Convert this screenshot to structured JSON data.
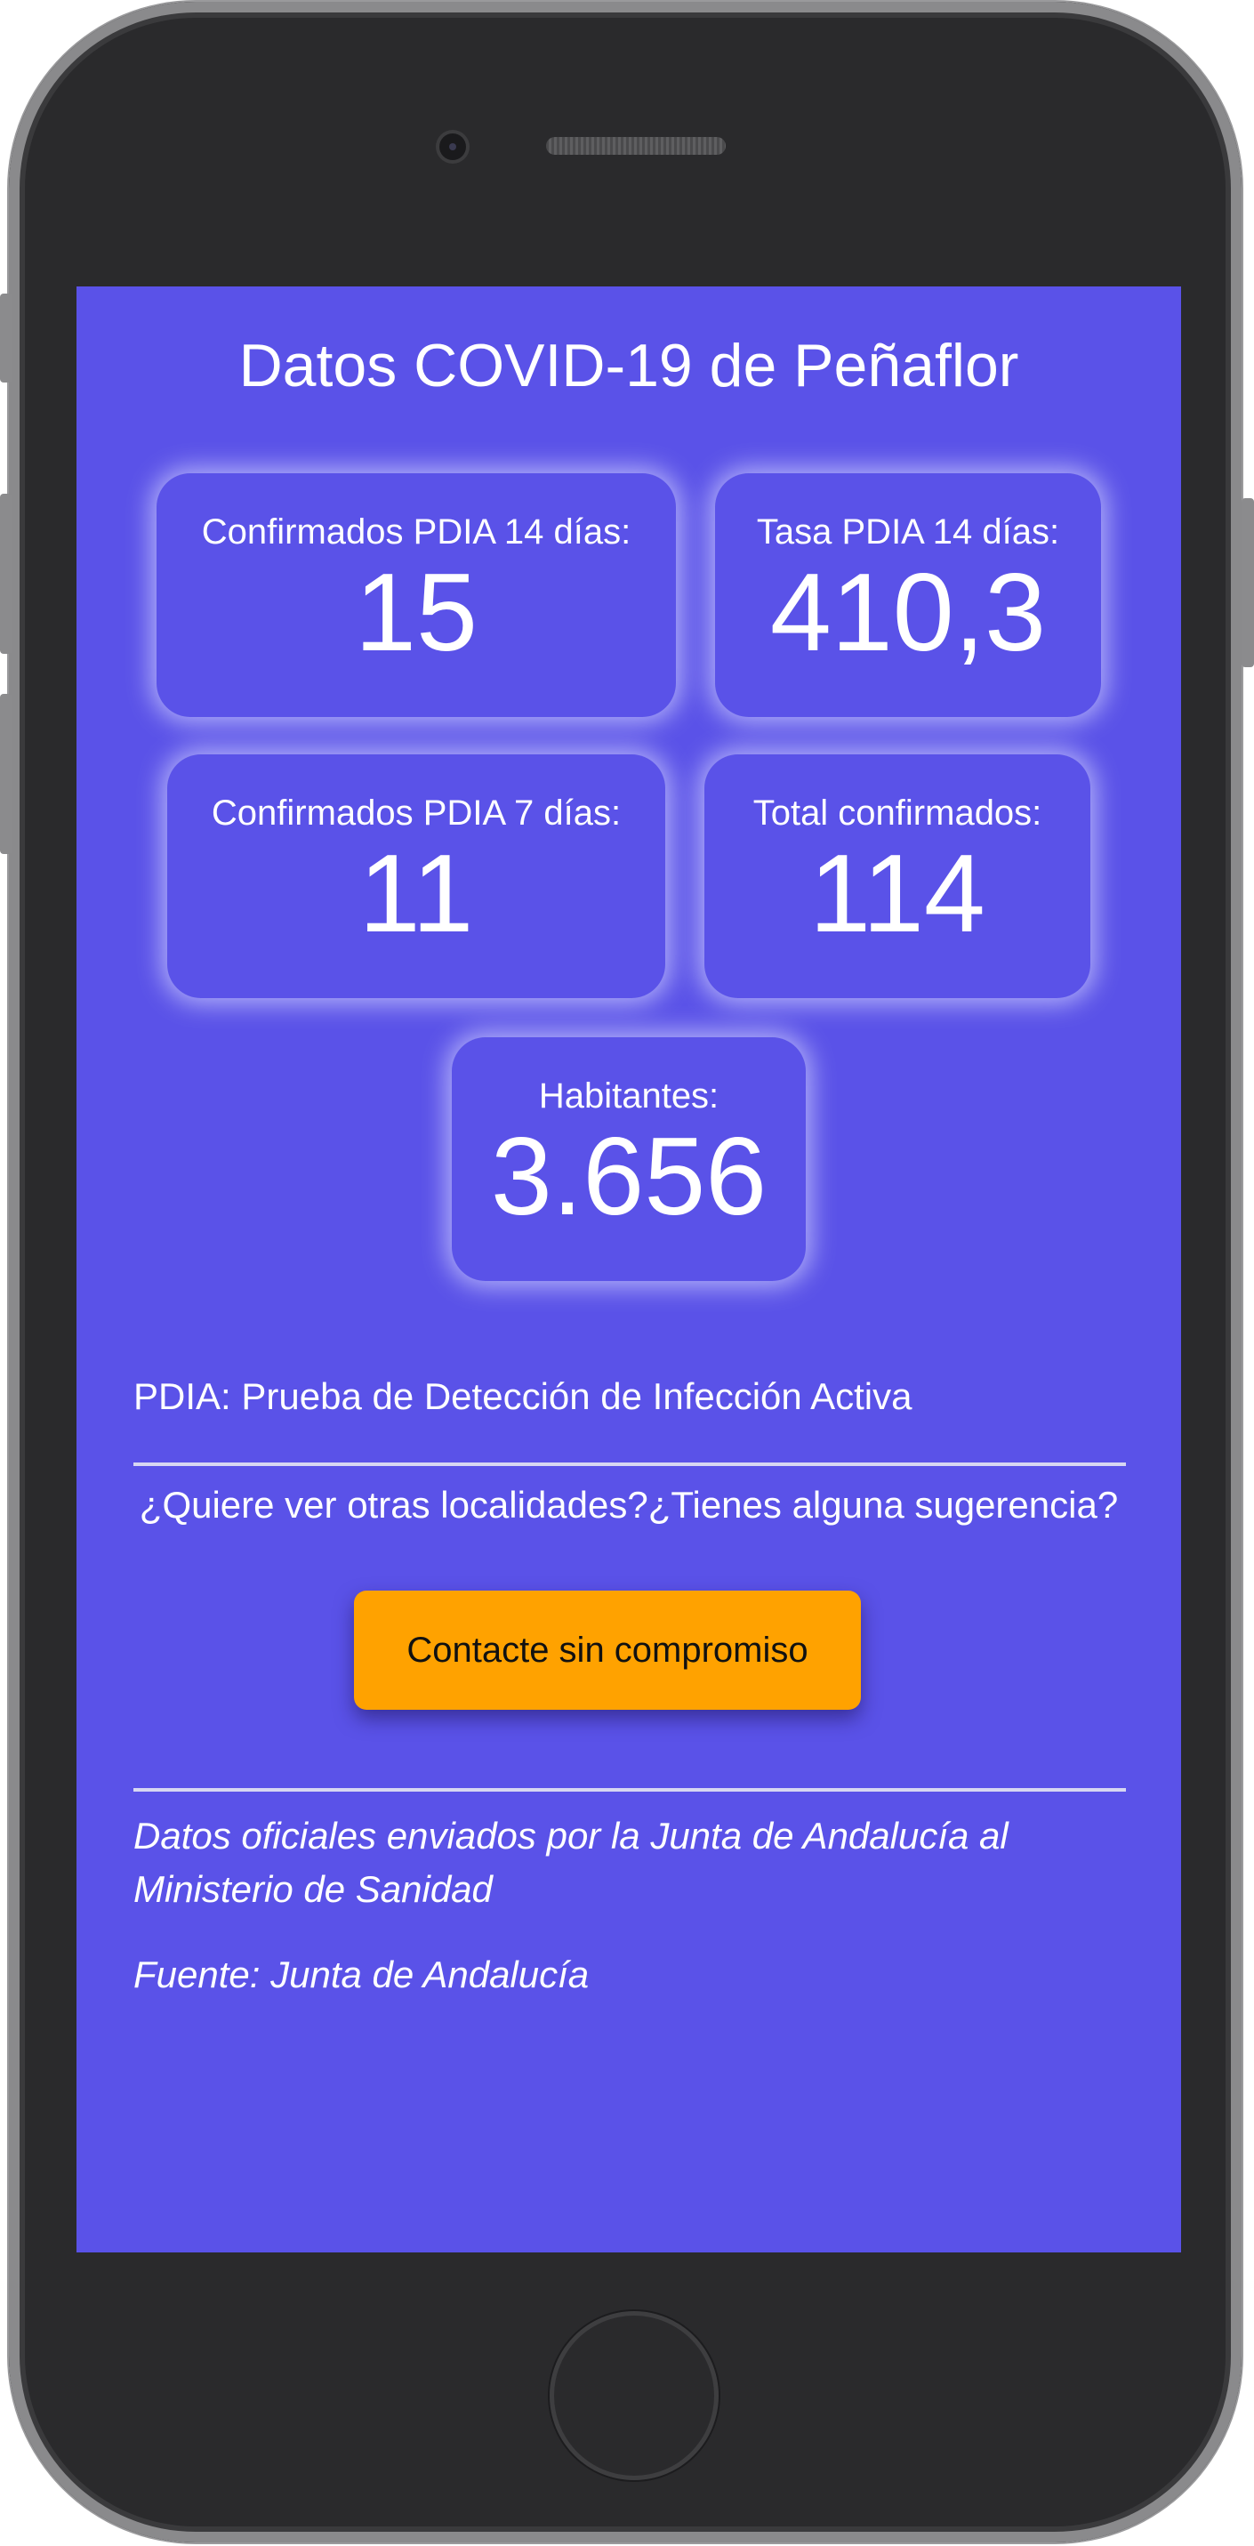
{
  "header": {
    "title": "Datos COVID-19 de Peñaflor"
  },
  "stats": [
    {
      "label": "Confirmados PDIA 14 días:",
      "value": "15"
    },
    {
      "label": "Tasa PDIA 14 días:",
      "value": "410,3"
    },
    {
      "label": "Confirmados PDIA 7 días:",
      "value": "11"
    },
    {
      "label": "Total confirmados:",
      "value": "114"
    },
    {
      "label": "Habitantes:",
      "value": "3.656"
    }
  ],
  "note": "PDIA: Prueba de Detección de Infección Activa",
  "question": "¿Quiere ver otras localidades?¿Tienes alguna sugerencia?",
  "contact_button_label": "Contacte sin compromiso",
  "footer": {
    "official_data": "Datos oficiales enviados por la Junta de Andalucía al Ministerio de Sanidad",
    "source": "Fuente: Junta de Andalucía"
  },
  "colors": {
    "screen_background": "#5a52e8",
    "button_background": "#ffa200",
    "text": "#ffffff"
  }
}
